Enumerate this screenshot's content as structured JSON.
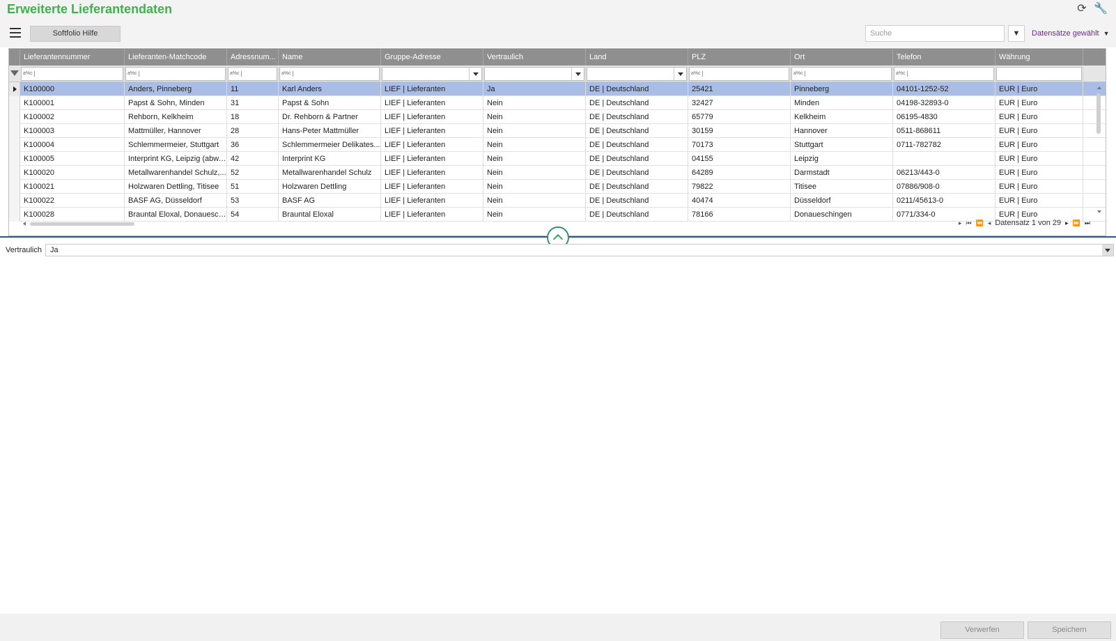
{
  "header": {
    "title": "Erweiterte Lieferantendaten",
    "refresh_icon": "refresh-icon",
    "settings_icon": "wrench-icon"
  },
  "toolbar": {
    "help_label": "Softfolio Hilfe",
    "search_placeholder": "Suche",
    "filter_icon": "funnel-icon",
    "records_selected_label": "Datensätze gewählt"
  },
  "grid": {
    "columns": [
      {
        "label": "Lieferantennummer"
      },
      {
        "label": "Lieferanten-Matchcode"
      },
      {
        "label": "Adressnum..."
      },
      {
        "label": "Name"
      },
      {
        "label": "Gruppe-Adresse"
      },
      {
        "label": "Vertraulich"
      },
      {
        "label": "Land"
      },
      {
        "label": "PLZ"
      },
      {
        "label": "Ort"
      },
      {
        "label": "Telefon"
      },
      {
        "label": "Währung"
      }
    ],
    "filters": [
      "abc",
      "abc",
      "abc",
      "abc",
      "dropdown",
      "dropdown",
      "dropdown",
      "abc",
      "abc",
      "abc",
      "text"
    ],
    "filter_abc_label": "a%c",
    "selected_row": 0,
    "rows": [
      [
        "K100000",
        "Anders, Pinneberg",
        "11",
        "Karl Anders",
        "LIEF  |  Lieferanten",
        "Ja",
        "DE  |  Deutschland",
        "25421",
        "Pinneberg",
        "04101-1252-52",
        "EUR  |  Euro"
      ],
      [
        "K100001",
        "Papst & Sohn, Minden",
        "31",
        "Papst & Sohn",
        "LIEF  |  Lieferanten",
        "Nein",
        "DE  |  Deutschland",
        "32427",
        "Minden",
        "04198-32893-0",
        "EUR  |  Euro"
      ],
      [
        "K100002",
        "Rehborn, Kelkheim",
        "18",
        "Dr. Rehborn & Partner",
        "LIEF  |  Lieferanten",
        "Nein",
        "DE  |  Deutschland",
        "65779",
        "Kelkheim",
        "06195-4830",
        "EUR  |  Euro"
      ],
      [
        "K100003",
        "Mattmüller, Hannover",
        "28",
        "Hans-Peter Mattmüller",
        "LIEF  |  Lieferanten",
        "Nein",
        "DE  |  Deutschland",
        "30159",
        "Hannover",
        "0511-868611",
        "EUR  |  Euro"
      ],
      [
        "K100004",
        "Schlemmermeier, Stuttgart",
        "36",
        "Schlemmermeier Delikates...",
        "LIEF  |  Lieferanten",
        "Nein",
        "DE  |  Deutschland",
        "70173",
        "Stuttgart",
        "0711-782782",
        "EUR  |  Euro"
      ],
      [
        "K100005",
        "Interprint KG, Leipzig (abw....",
        "42",
        "Interprint KG",
        "LIEF  |  Lieferanten",
        "Nein",
        "DE  |  Deutschland",
        "04155",
        "Leipzig",
        "",
        "EUR  |  Euro"
      ],
      [
        "K100020",
        "Metallwarenhandel Schulz,...",
        "52",
        "Metallwarenhandel Schulz",
        "LIEF  |  Lieferanten",
        "Nein",
        "DE  |  Deutschland",
        "64289",
        "Darmstadt",
        "06213/443-0",
        "EUR  |  Euro"
      ],
      [
        "K100021",
        "Holzwaren Dettling, Titisee",
        "51",
        "Holzwaren Dettling",
        "LIEF  |  Lieferanten",
        "Nein",
        "DE  |  Deutschland",
        "79822",
        "Titisee",
        "07886/908-0",
        "EUR  |  Euro"
      ],
      [
        "K100022",
        "BASF AG, Düsseldorf",
        "53",
        "BASF AG",
        "LIEF  |  Lieferanten",
        "Nein",
        "DE  |  Deutschland",
        "40474",
        "Düsseldorf",
        "0211/45613-0",
        "EUR  |  Euro"
      ],
      [
        "K100028",
        "Brauntal Eloxal, Donauesch...",
        "54",
        "Brauntal Eloxal",
        "LIEF  |  Lieferanten",
        "Nein",
        "DE  |  Deutschland",
        "78166",
        "Donaueschingen",
        "0771/334-0",
        "EUR  |  Euro"
      ]
    ]
  },
  "pager": {
    "text": "Datensatz 1 von 29"
  },
  "detail": {
    "label": "Vertraulich",
    "value": "Ja"
  },
  "footer": {
    "discard_label": "Verwerfen",
    "save_label": "Speichern"
  }
}
